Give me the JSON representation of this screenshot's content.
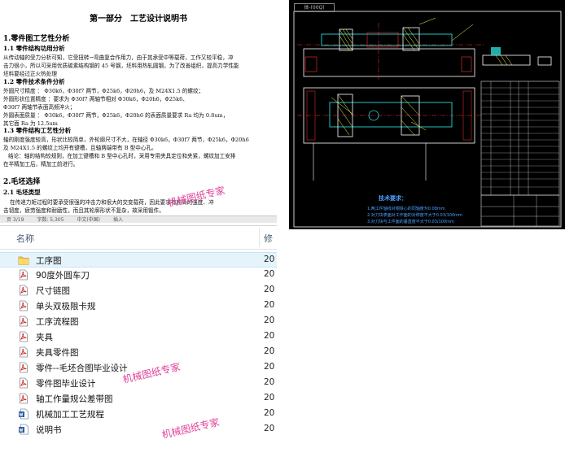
{
  "document": {
    "title": "第一部分　工艺设计说明书",
    "headings": {
      "h1_1": "1.零件图工艺性分析",
      "h2_1": "1.1 零件结构功用分析",
      "h2_2": "1.2 零件技术条件分析",
      "h2_3": "1.3 零件结构工艺性分析",
      "h1_2": "2.毛坯选择",
      "h2_4": "2.1 毛坯类型"
    },
    "lines": {
      "p1a": "从传动轴的受力分析可知，它受扭转→弯曲复合作用力，由于其承受中等载荷，工作又较平稳，冲",
      "p1b": "击力很小，所以可采用优质碳素结构钢的 45 号钢，坯料用热轧圆钢，为了改善组织，提高力学性能",
      "p1c": "坯料要经过正火热处理",
      "p2a": "外圆尺寸精度 ：  Φ30k6，Φ30f7 两节，Φ25k6，Φ20h6，及 M24X1.5 的螺纹；",
      "p2b": "外圆形状位置精度 ：要求为 Φ30f7 两轴节相对 Φ30k6，Φ20h6，Φ25k6、",
      "p2c": "Φ30f7 两轴节表面高频淬火；",
      "p2d": "外圆表面质量 ：  Φ30k6，Φ30f7 两节，Φ25k6，Φ20h6 的表面质量要求 Ra 均为 0.8um，",
      "p2e": "其它面 Ra 为 12.5um",
      "p3a": "轴的刚度强度较高，形状比较简单，外轮廓尺寸不大，在轴径 Φ30k6，Φ30f7 两节，Φ25k6，Φ20h6",
      "p3b": "及 M24X1.5 的螺纹上均开有键槽，且轴两端带有 B 型中心孔。",
      "p3c": "结论：轴的结构较规则，在加工键槽和 B 型中心孔时，采用专用夹具定位和夹紧，螺纹加工安排",
      "p3d": "在半精加工后，精加工前进行。",
      "p4a": "在传递力矩过程时要承受很强的冲击力和很大的交变载荷，因此要求有较高的强度、冲",
      "p4b": "击韧度，疲劳强度和耐磨性，而且其轮廓形状不复杂，故采用锻件。"
    },
    "status": {
      "page": "页 3/19",
      "words": "字数: 5,305",
      "lang": "中文(中国)",
      "mode": "插入"
    },
    "watermark": "机械图纸专家"
  },
  "explorer": {
    "column_name": "名称",
    "column_modified": "修",
    "items": [
      {
        "name": "工序图",
        "type": "folder",
        "date": "20"
      },
      {
        "name": "90度外圆车刀",
        "type": "pdf",
        "date": "20"
      },
      {
        "name": "尺寸链图",
        "type": "pdf",
        "date": "20"
      },
      {
        "name": "单头双极限卡规",
        "type": "pdf",
        "date": "20"
      },
      {
        "name": "工序流程图",
        "type": "pdf",
        "date": "20"
      },
      {
        "name": "夹具",
        "type": "pdf",
        "date": "20"
      },
      {
        "name": "夹具零件图",
        "type": "pdf",
        "date": "20"
      },
      {
        "name": "零件--毛坯合图毕业设计",
        "type": "pdf",
        "date": "20"
      },
      {
        "name": "零件图毕业设计",
        "type": "pdf",
        "date": "20"
      },
      {
        "name": "轴工作量规公差带图",
        "type": "pdf",
        "date": "20"
      },
      {
        "name": "机械加工工艺规程",
        "type": "doc",
        "date": "20"
      },
      {
        "name": "说明书",
        "type": "doc",
        "date": "20"
      }
    ],
    "watermark1": "机械图纸专家",
    "watermark2": "机械图纸专家"
  },
  "cad": {
    "tab_label": "体-(00Q)",
    "tech_title": "技术要求：",
    "tech_lines": [
      "1.两工件轴线对钢铁心的同轴度为0.08mm",
      "2.对刀块表面对工作面的对称度不大于0.03/100mm",
      "3.对刀块与工件面的垂直度不大于0.03/100mm"
    ],
    "colors": {
      "background": "#000000",
      "outline": "#ffffff",
      "hidden": "#ff3030",
      "center": "#ff3030",
      "part": "#2ad8d8",
      "hatch": "#ffff55",
      "tech": "#4ea0ff",
      "table": "#e0e0e0"
    }
  },
  "icons": {
    "folder": "folder-icon",
    "pdf": "pdf-file-icon",
    "doc": "word-document-icon"
  }
}
